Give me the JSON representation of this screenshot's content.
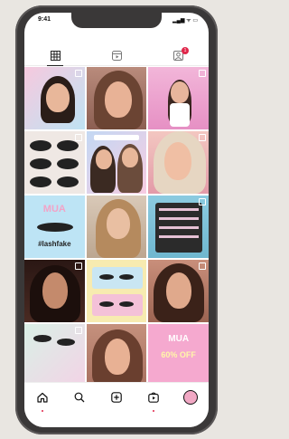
{
  "status_bar": {
    "time": "9:41",
    "icons": "▂▄▆ ᯤ ▭"
  },
  "profile_tabs": [
    {
      "icon": "grid-icon"
    },
    {
      "icon": "reels-icon"
    },
    {
      "icon": "tagged-icon",
      "badge": "1"
    }
  ],
  "grid_overlays": {
    "cell_7_top": "MUA",
    "cell_7_bottom": "#lashfake",
    "cell_15_top": "MUA",
    "cell_15_bottom": "60% OFF"
  },
  "bottom_nav": [
    {
      "icon": "home-icon"
    },
    {
      "icon": "search-icon"
    },
    {
      "icon": "add-post-icon"
    },
    {
      "icon": "shop-icon"
    },
    {
      "icon": "profile-avatar-icon"
    }
  ],
  "colors": {
    "accent": "#e0264a",
    "frame": "#3a3838"
  }
}
